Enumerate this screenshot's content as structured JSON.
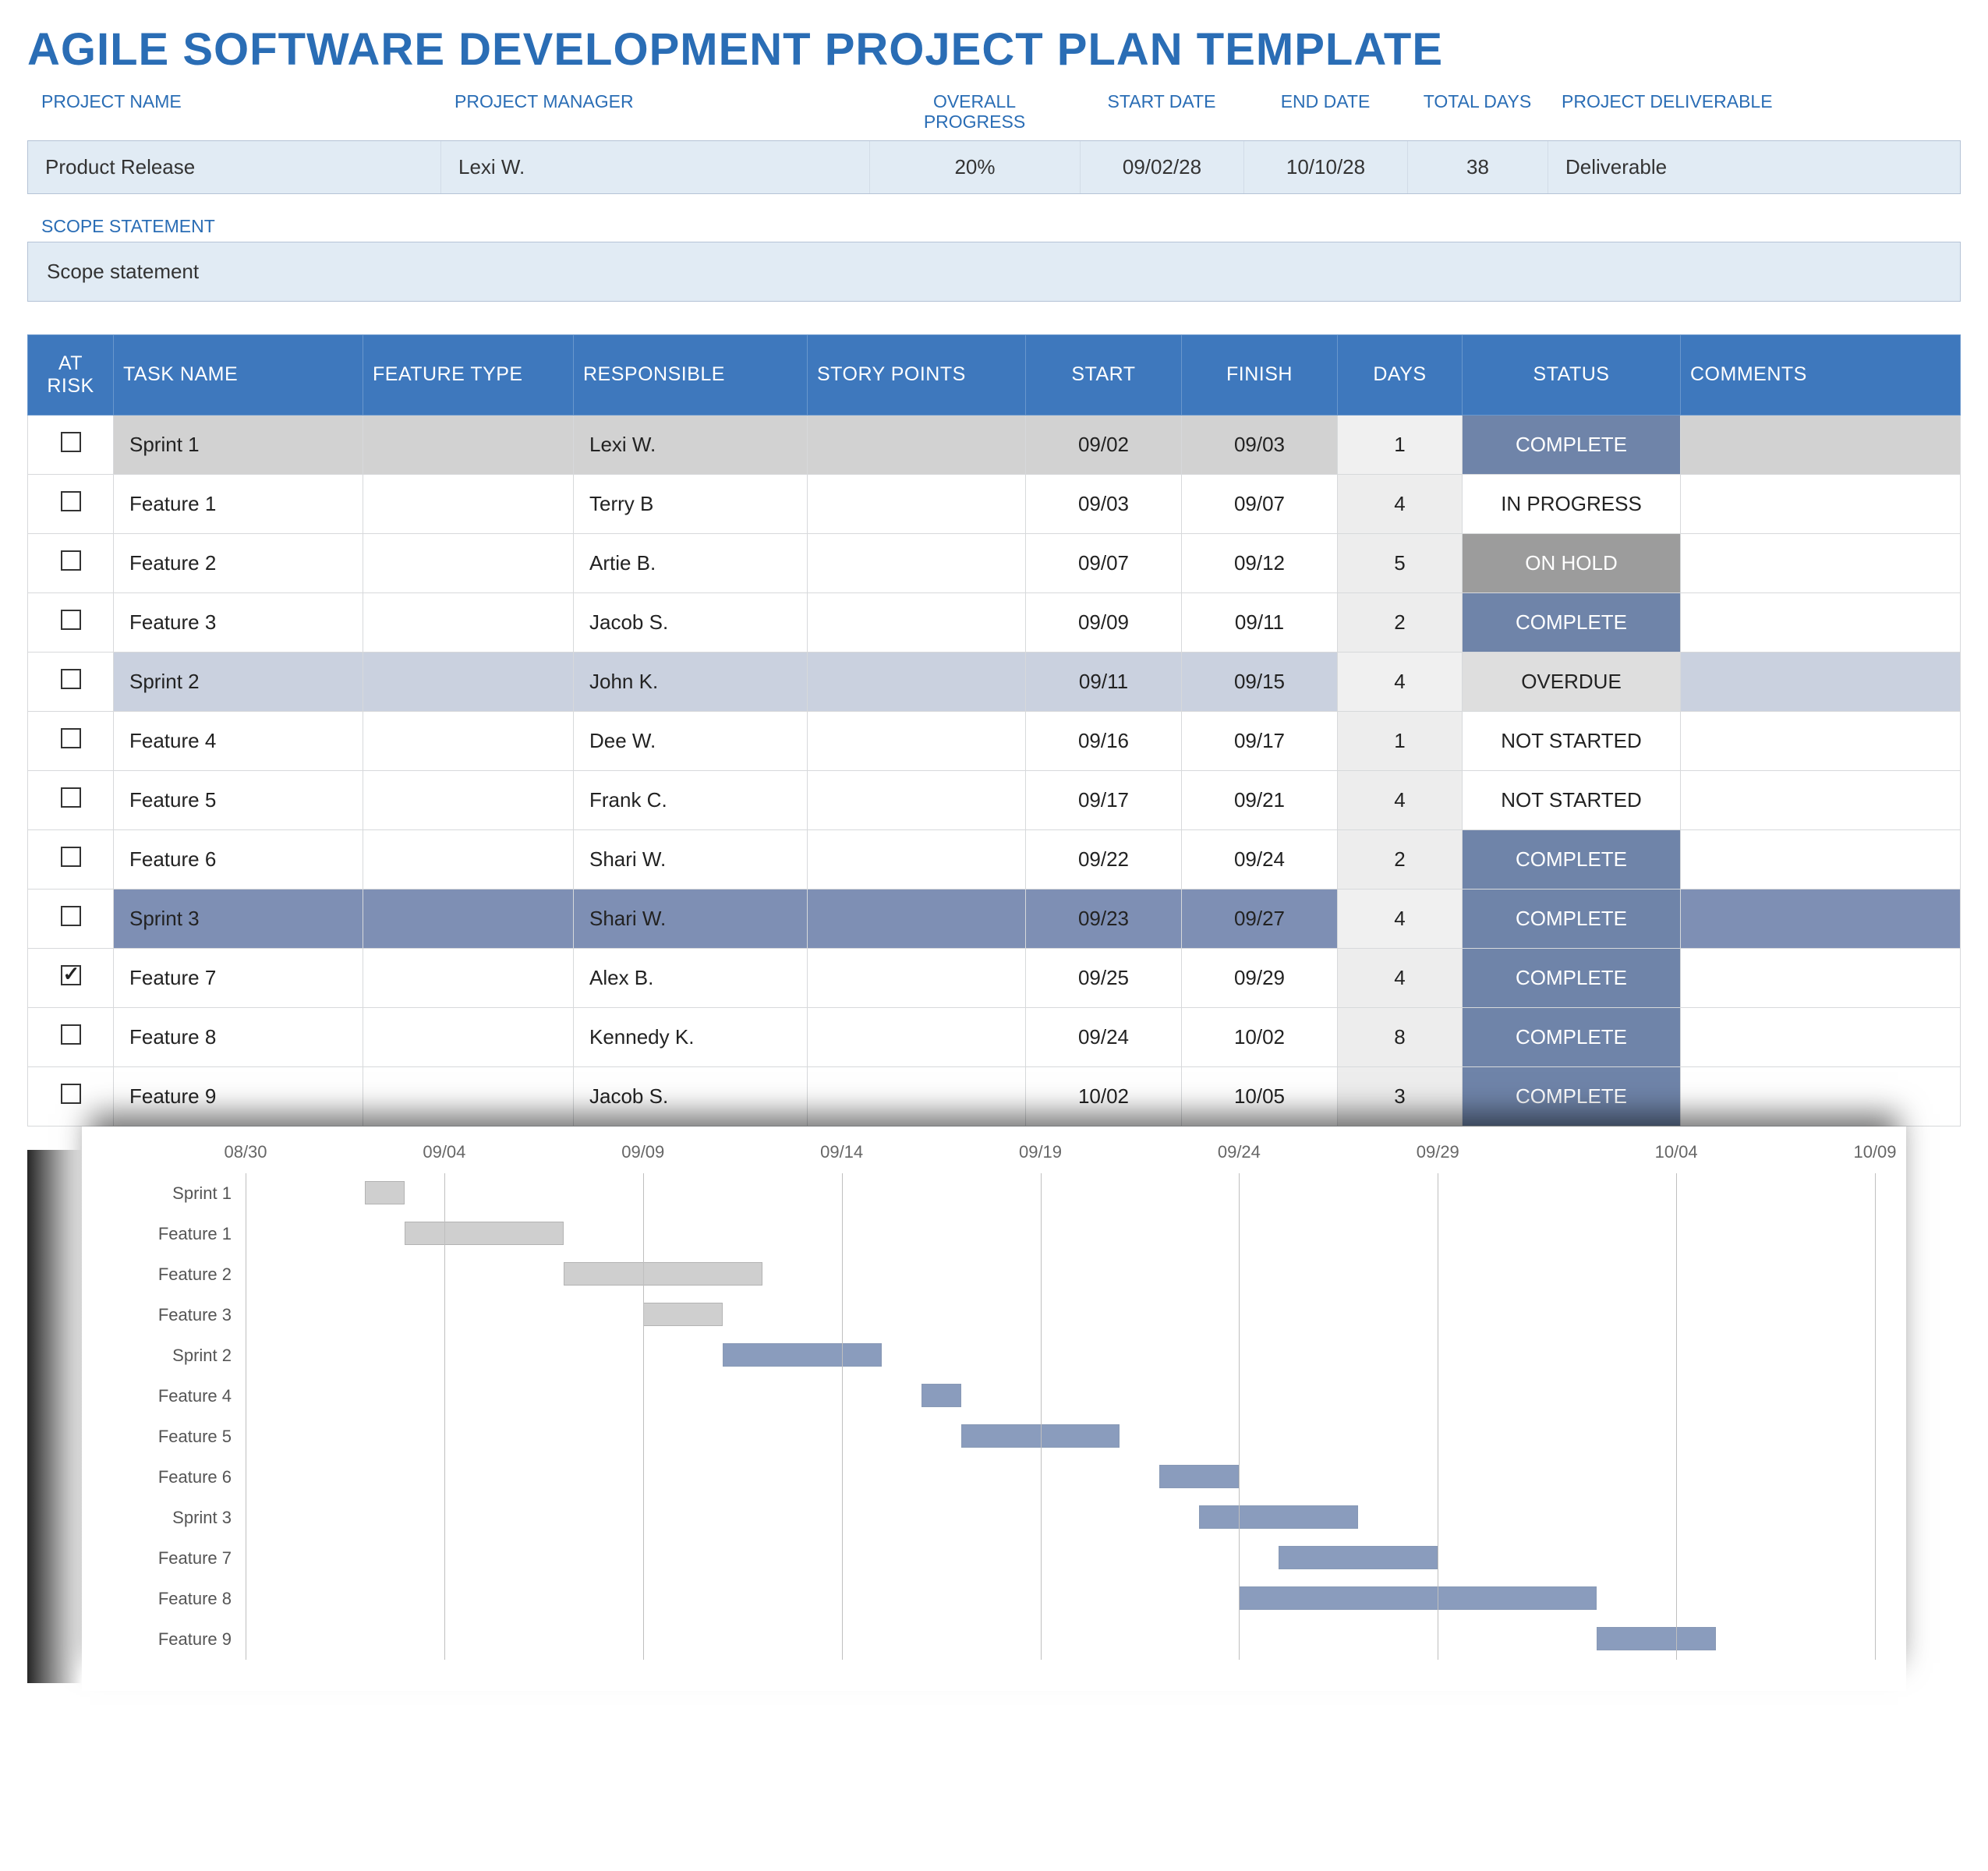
{
  "title": "AGILE SOFTWARE DEVELOPMENT PROJECT PLAN TEMPLATE",
  "info_headers": {
    "project_name": "PROJECT NAME",
    "project_manager": "PROJECT MANAGER",
    "overall_progress": "OVERALL PROGRESS",
    "start_date": "START DATE",
    "end_date": "END DATE",
    "total_days": "TOTAL DAYS",
    "deliverable": "PROJECT DELIVERABLE"
  },
  "info_values": {
    "project_name": "Product Release",
    "project_manager": "Lexi W.",
    "overall_progress": "20%",
    "start_date": "09/02/28",
    "end_date": "10/10/28",
    "total_days": "38",
    "deliverable": "Deliverable"
  },
  "scope_label": "SCOPE STATEMENT",
  "scope_value": "Scope statement",
  "columns": {
    "at_risk": "AT RISK",
    "task_name": "TASK NAME",
    "feature_type": "FEATURE TYPE",
    "responsible": "RESPONSIBLE",
    "story_points": "STORY POINTS",
    "start": "START",
    "finish": "FINISH",
    "days": "DAYS",
    "status": "STATUS",
    "comments": "COMMENTS"
  },
  "rows": [
    {
      "at_risk": false,
      "task_name": "Sprint 1",
      "feature_type": "",
      "responsible": "Lexi W.",
      "story_points": "",
      "start": "09/02",
      "finish": "09/03",
      "days": "1",
      "status": "COMPLETE",
      "row_class": "sprint1",
      "status_class": "complete"
    },
    {
      "at_risk": false,
      "task_name": "Feature 1",
      "feature_type": "",
      "responsible": "Terry B",
      "story_points": "",
      "start": "09/03",
      "finish": "09/07",
      "days": "4",
      "status": "IN PROGRESS",
      "row_class": "",
      "status_class": ""
    },
    {
      "at_risk": false,
      "task_name": "Feature 2",
      "feature_type": "",
      "responsible": "Artie B.",
      "story_points": "",
      "start": "09/07",
      "finish": "09/12",
      "days": "5",
      "status": "ON HOLD",
      "row_class": "",
      "status_class": "onhold"
    },
    {
      "at_risk": false,
      "task_name": "Feature 3",
      "feature_type": "",
      "responsible": "Jacob S.",
      "story_points": "",
      "start": "09/09",
      "finish": "09/11",
      "days": "2",
      "status": "COMPLETE",
      "row_class": "",
      "status_class": "complete"
    },
    {
      "at_risk": false,
      "task_name": "Sprint 2",
      "feature_type": "",
      "responsible": "John K.",
      "story_points": "",
      "start": "09/11",
      "finish": "09/15",
      "days": "4",
      "status": "OVERDUE",
      "row_class": "sprint2",
      "status_class": "overdue"
    },
    {
      "at_risk": false,
      "task_name": "Feature 4",
      "feature_type": "",
      "responsible": "Dee W.",
      "story_points": "",
      "start": "09/16",
      "finish": "09/17",
      "days": "1",
      "status": "NOT STARTED",
      "row_class": "",
      "status_class": ""
    },
    {
      "at_risk": false,
      "task_name": "Feature 5",
      "feature_type": "",
      "responsible": "Frank C.",
      "story_points": "",
      "start": "09/17",
      "finish": "09/21",
      "days": "4",
      "status": "NOT STARTED",
      "row_class": "",
      "status_class": ""
    },
    {
      "at_risk": false,
      "task_name": "Feature 6",
      "feature_type": "",
      "responsible": "Shari W.",
      "story_points": "",
      "start": "09/22",
      "finish": "09/24",
      "days": "2",
      "status": "COMPLETE",
      "row_class": "",
      "status_class": "complete"
    },
    {
      "at_risk": false,
      "task_name": "Sprint 3",
      "feature_type": "",
      "responsible": "Shari W.",
      "story_points": "",
      "start": "09/23",
      "finish": "09/27",
      "days": "4",
      "status": "COMPLETE",
      "row_class": "sprint3",
      "status_class": "complete"
    },
    {
      "at_risk": true,
      "task_name": "Feature 7",
      "feature_type": "",
      "responsible": "Alex B.",
      "story_points": "",
      "start": "09/25",
      "finish": "09/29",
      "days": "4",
      "status": "COMPLETE",
      "row_class": "",
      "status_class": "complete"
    },
    {
      "at_risk": false,
      "task_name": "Feature 8",
      "feature_type": "",
      "responsible": "Kennedy K.",
      "story_points": "",
      "start": "09/24",
      "finish": "10/02",
      "days": "8",
      "status": "COMPLETE",
      "row_class": "",
      "status_class": "complete"
    },
    {
      "at_risk": false,
      "task_name": "Feature 9",
      "feature_type": "",
      "responsible": "Jacob S.",
      "story_points": "",
      "start": "10/02",
      "finish": "10/05",
      "days": "3",
      "status": "COMPLETE",
      "row_class": "",
      "status_class": "complete"
    }
  ],
  "chart_data": {
    "type": "gantt",
    "x_range": [
      "08/30",
      "10/09"
    ],
    "x_ticks": [
      "08/30",
      "09/04",
      "09/09",
      "09/14",
      "09/19",
      "09/24",
      "09/29",
      "10/04",
      "10/09"
    ],
    "series": [
      {
        "name": "Sprint 1",
        "start": "09/02",
        "finish": "09/03",
        "color": "grey"
      },
      {
        "name": "Feature 1",
        "start": "09/03",
        "finish": "09/07",
        "color": "grey"
      },
      {
        "name": "Feature 2",
        "start": "09/07",
        "finish": "09/12",
        "color": "grey"
      },
      {
        "name": "Feature 3",
        "start": "09/09",
        "finish": "09/11",
        "color": "grey"
      },
      {
        "name": "Sprint 2",
        "start": "09/11",
        "finish": "09/15",
        "color": "blue"
      },
      {
        "name": "Feature 4",
        "start": "09/16",
        "finish": "09/17",
        "color": "blue"
      },
      {
        "name": "Feature 5",
        "start": "09/17",
        "finish": "09/21",
        "color": "blue"
      },
      {
        "name": "Feature 6",
        "start": "09/22",
        "finish": "09/24",
        "color": "blue"
      },
      {
        "name": "Sprint 3",
        "start": "09/23",
        "finish": "09/27",
        "color": "blue"
      },
      {
        "name": "Feature 7",
        "start": "09/25",
        "finish": "09/29",
        "color": "blue"
      },
      {
        "name": "Feature 8",
        "start": "09/24",
        "finish": "10/02",
        "color": "blue"
      },
      {
        "name": "Feature 9",
        "start": "10/02",
        "finish": "10/05",
        "color": "blue"
      }
    ]
  }
}
